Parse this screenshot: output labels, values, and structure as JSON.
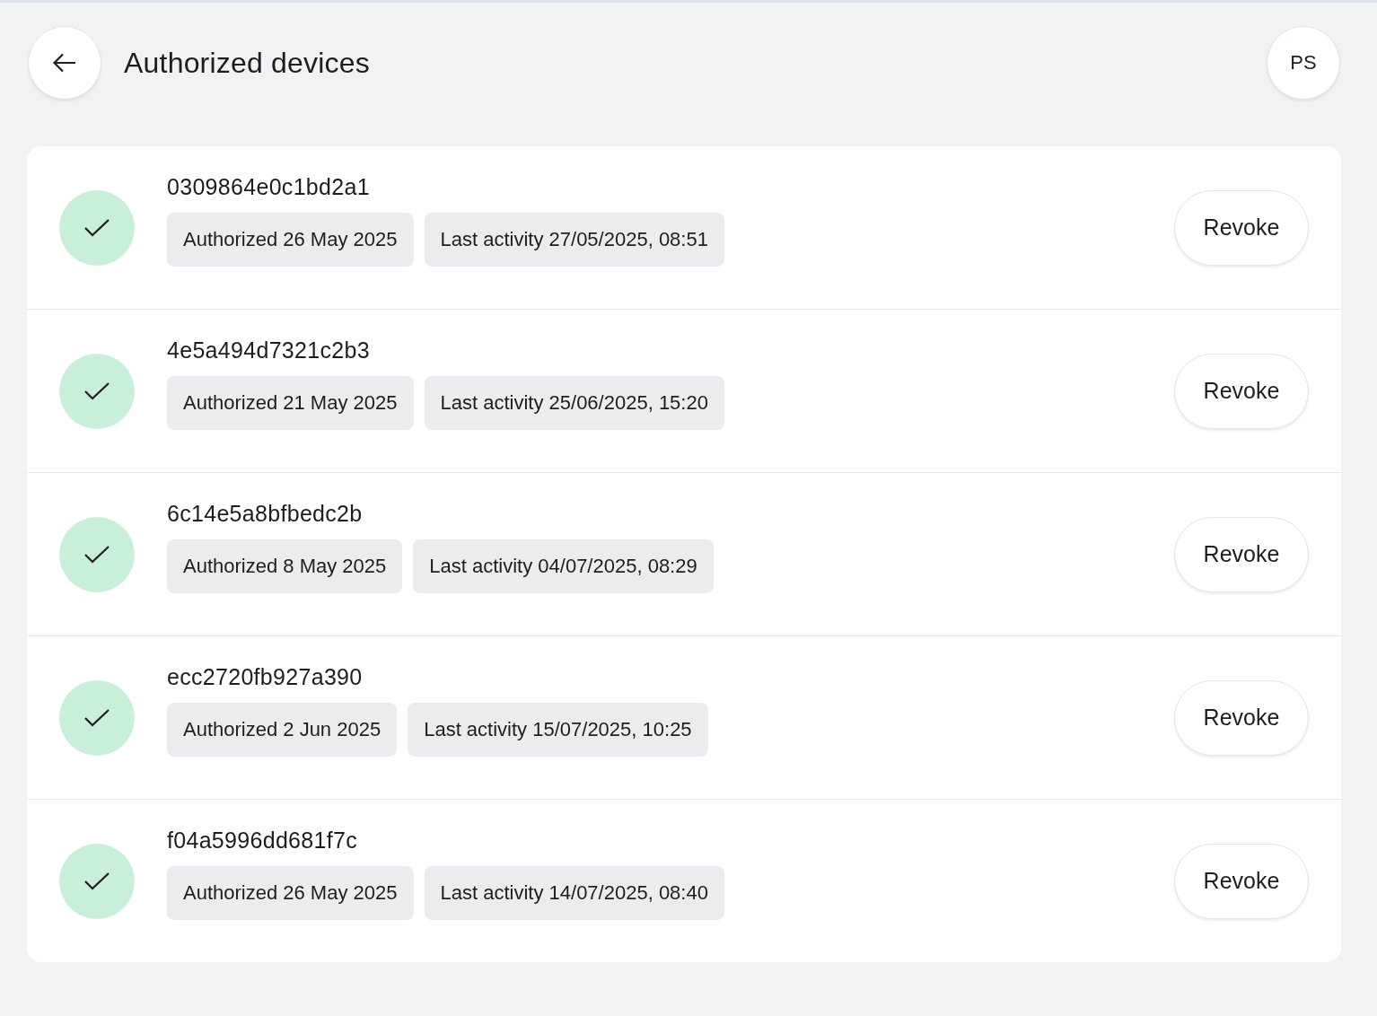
{
  "header": {
    "title": "Authorized devices",
    "avatar_initials": "PS"
  },
  "devices": [
    {
      "id": "0309864e0c1bd2a1",
      "authorized": "Authorized 26 May 2025",
      "last_activity": "Last activity 27/05/2025, 08:51",
      "action": "Revoke"
    },
    {
      "id": "4e5a494d7321c2b3",
      "authorized": "Authorized 21 May 2025",
      "last_activity": "Last activity 25/06/2025, 15:20",
      "action": "Revoke"
    },
    {
      "id": "6c14e5a8bfbedc2b",
      "authorized": "Authorized 8 May 2025",
      "last_activity": "Last activity 04/07/2025, 08:29",
      "action": "Revoke"
    },
    {
      "id": "ecc2720fb927a390",
      "authorized": "Authorized 2 Jun 2025",
      "last_activity": "Last activity 15/07/2025, 10:25",
      "action": "Revoke"
    },
    {
      "id": "f04a5996dd681f7c",
      "authorized": "Authorized 26 May 2025",
      "last_activity": "Last activity 14/07/2025, 08:40",
      "action": "Revoke"
    }
  ]
}
